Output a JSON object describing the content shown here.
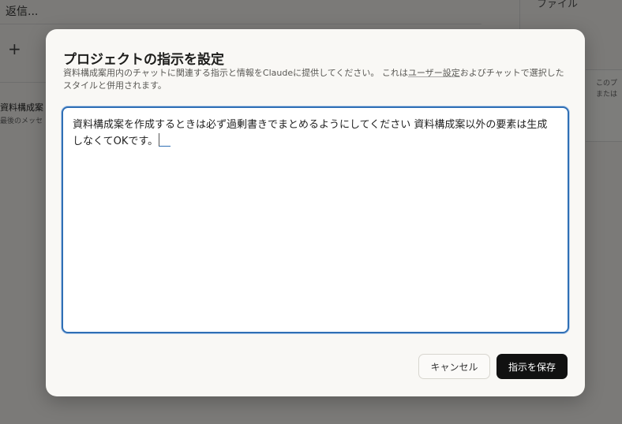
{
  "background": {
    "reply_placeholder": "返信...",
    "plus_icon": "+",
    "item_title": "資料構成案",
    "item_subtitle": "最後のメッセ",
    "right_header": "ファイル",
    "right_text_1": "このプ",
    "right_text_2": "または"
  },
  "modal": {
    "title": "プロジェクトの指示を設定",
    "desc_part1": "資料構成案用内のチャットに関連する指示と情報をClaudeに提供してください。 これは",
    "desc_link": "ユーザー設定",
    "desc_part2": "およびチャットで選択したスタイルと併用されます。",
    "instructions_value": "資料構成案を作成するときは必ず過剰書きでまとめるようにしてください 資料構成案以外の要素は生成しなくてOKです。",
    "cancel_label": "キャンセル",
    "save_label": "指示を保存"
  },
  "colors": {
    "accent_border": "#2f6fb5",
    "primary_button": "#111111",
    "modal_bg": "#f9f8f5"
  }
}
